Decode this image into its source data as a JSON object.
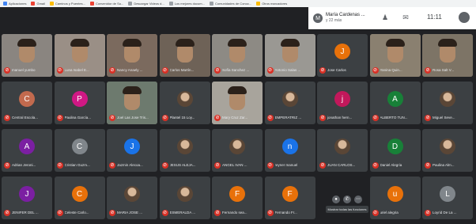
{
  "bookmarks": [
    {
      "label": "Aplicaciones",
      "color": "blue"
    },
    {
      "label": "Gmail",
      "color": "red"
    },
    {
      "label": "Caminos y Puentes...",
      "color": "yellow"
    },
    {
      "label": "Convenidor de Su...",
      "color": "red"
    },
    {
      "label": "Descargar Videos d...",
      "color": "gray"
    },
    {
      "label": "Los mejores docum...",
      "color": "gray"
    },
    {
      "label": "Comunidades de Conoc...",
      "color": "gray"
    },
    {
      "label": "Otros marcadores",
      "color": "yellow"
    }
  ],
  "presenter": {
    "initial": "M",
    "name": "María Cardenas ...",
    "sub": "y 22 más"
  },
  "clock": "11:11",
  "participants": [
    {
      "name": "manuel yumbo",
      "type": "video",
      "bg": "#8a8580"
    },
    {
      "name": "Luna Isabel E...",
      "type": "video",
      "bg": "#9a8f86"
    },
    {
      "name": "Nancy Anaely ...",
      "type": "video",
      "bg": "#7b6a5e"
    },
    {
      "name": "Carlos Martín...",
      "type": "video",
      "bg": "#6e6257"
    },
    {
      "name": "Sofía Sanchez ...",
      "type": "video",
      "bg": "#8d8a84"
    },
    {
      "name": "Antonio Salas ...",
      "type": "video",
      "bg": "#9a9893"
    },
    {
      "name": "Jose Carlos",
      "type": "avatar",
      "initial": "J",
      "color": "#e8710a"
    },
    {
      "name": "Yanina Quin...",
      "type": "video",
      "bg": "#8a8070"
    },
    {
      "name": "Rosa Salt V...",
      "type": "video",
      "bg": "#7d7466"
    },
    {
      "name": "Central Escola...",
      "type": "avatar",
      "initial": "C",
      "color": "#c26a4e"
    },
    {
      "name": "Paulina García...",
      "type": "avatar",
      "initial": "P",
      "color": "#d01884"
    },
    {
      "name": "Joel Las Jose Tris...",
      "type": "video",
      "bg": "#6d7a6e"
    },
    {
      "name": "Plantel 15 Loy...",
      "type": "photo"
    },
    {
      "name": "Mary Cruz Zar...",
      "type": "video",
      "bg": "#a8a49c"
    },
    {
      "name": "EMPERATRIZ ...",
      "type": "photo"
    },
    {
      "name": "jonathan hern...",
      "type": "avatar",
      "initial": "j",
      "color": "#c2185b"
    },
    {
      "name": "ALBERTO TUN...",
      "type": "avatar",
      "initial": "A",
      "color": "#188038"
    },
    {
      "name": "Miguel Seve...",
      "type": "photo"
    },
    {
      "name": "Adrian Jeroni...",
      "type": "avatar",
      "initial": "A",
      "color": "#7b1fa2"
    },
    {
      "name": "Cristian Guzm...",
      "type": "avatar",
      "initial": "C",
      "color": "#80868b"
    },
    {
      "name": "Jazmin Alecoa...",
      "type": "avatar",
      "initial": "J",
      "color": "#1a73e8"
    },
    {
      "name": "JESUS ALEJA...",
      "type": "photo"
    },
    {
      "name": "ANGEL IVAN ...",
      "type": "photo"
    },
    {
      "name": "reyner manuel",
      "type": "avatar",
      "initial": "n",
      "color": "#1a73e8"
    },
    {
      "name": "JUAN CARLOS...",
      "type": "photo"
    },
    {
      "name": "Daniel Alegria",
      "type": "avatar",
      "initial": "D",
      "color": "#188038"
    },
    {
      "name": "Paulina Alm...",
      "type": "photo"
    },
    {
      "name": "JENIFER DEL ...",
      "type": "avatar",
      "initial": "J",
      "color": "#7b1fa2"
    },
    {
      "name": "Celeste Carlo...",
      "type": "avatar",
      "initial": "C",
      "color": "#e8710a"
    },
    {
      "name": "MARIA JOSE ...",
      "type": "photo"
    },
    {
      "name": "ESMERALDA ...",
      "type": "photo"
    },
    {
      "name": "Fernando sea...",
      "type": "avatar",
      "initial": "F",
      "color": "#e8710a"
    },
    {
      "name": "Fernando Fr...",
      "type": "avatar",
      "initial": "F",
      "color": "#e8710a"
    },
    {
      "name": "",
      "type": "empty"
    },
    {
      "name": "uriel alegria",
      "type": "avatar",
      "initial": "u",
      "color": "#e8710a"
    },
    {
      "name": "Loyrid De La ...",
      "type": "avatar",
      "initial": "L",
      "color": "#80868b"
    }
  ],
  "toolbar": {
    "tooltip": "Mostrar todas las funciones"
  },
  "colors": {
    "background": "#202124",
    "tile": "#3c4043",
    "muted": "#d93025"
  }
}
